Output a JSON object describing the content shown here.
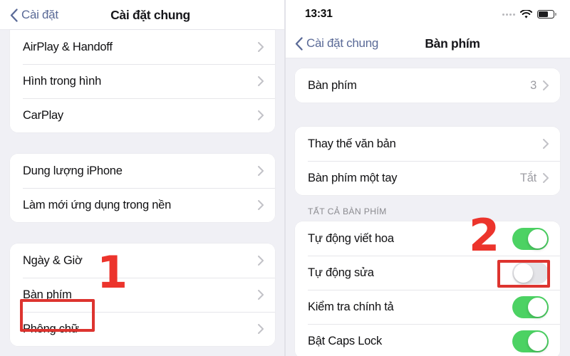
{
  "left": {
    "nav": {
      "back_label": "Cài đặt",
      "title": "Cài đặt chung",
      "back_icon": "chevron-left-icon"
    },
    "group1": [
      {
        "label": "AirPlay & Handoff",
        "accessory": "chevron-right-icon"
      },
      {
        "label": "Hình trong hình",
        "accessory": "chevron-right-icon"
      },
      {
        "label": "CarPlay",
        "accessory": "chevron-right-icon"
      }
    ],
    "group2": [
      {
        "label": "Dung lượng iPhone",
        "accessory": "chevron-right-icon"
      },
      {
        "label": "Làm mới ứng dụng trong nền",
        "accessory": "chevron-right-icon"
      }
    ],
    "group3": [
      {
        "label": "Ngày & Giờ",
        "accessory": "chevron-right-icon"
      },
      {
        "label": "Bàn phím",
        "accessory": "chevron-right-icon"
      },
      {
        "label": "Phông chữ",
        "accessory": "chevron-right-icon"
      }
    ],
    "annotation": {
      "number": "1"
    }
  },
  "right": {
    "statusbar": {
      "time": "13:31",
      "signal_icon": "signal-dots-icon",
      "wifi_icon": "wifi-icon",
      "battery_icon": "battery-icon"
    },
    "nav": {
      "back_label": "Cài đặt chung",
      "title": "Bàn phím",
      "back_icon": "chevron-left-icon"
    },
    "group1": [
      {
        "label": "Bàn phím",
        "value": "3",
        "accessory": "chevron-right-icon"
      }
    ],
    "group2": [
      {
        "label": "Thay thế văn bản",
        "value": "",
        "accessory": "chevron-right-icon"
      },
      {
        "label": "Bàn phím một tay",
        "value": "Tắt",
        "accessory": "chevron-right-icon"
      }
    ],
    "section_header": "TẤT CẢ BÀN PHÍM",
    "group3": [
      {
        "label": "Tự động viết hoa",
        "state": "on"
      },
      {
        "label": "Tự động sửa",
        "state": "off"
      },
      {
        "label": "Kiểm tra chính tả",
        "state": "on"
      },
      {
        "label": "Bật Caps Lock",
        "state": "on"
      }
    ],
    "annotation": {
      "number": "2"
    }
  },
  "colors": {
    "accent_blue": "#5a6a97",
    "toggle_on": "#4cd263",
    "toggle_off": "#e4e4e8",
    "annotation_red": "#dd342f",
    "background": "#f0f0f5"
  }
}
